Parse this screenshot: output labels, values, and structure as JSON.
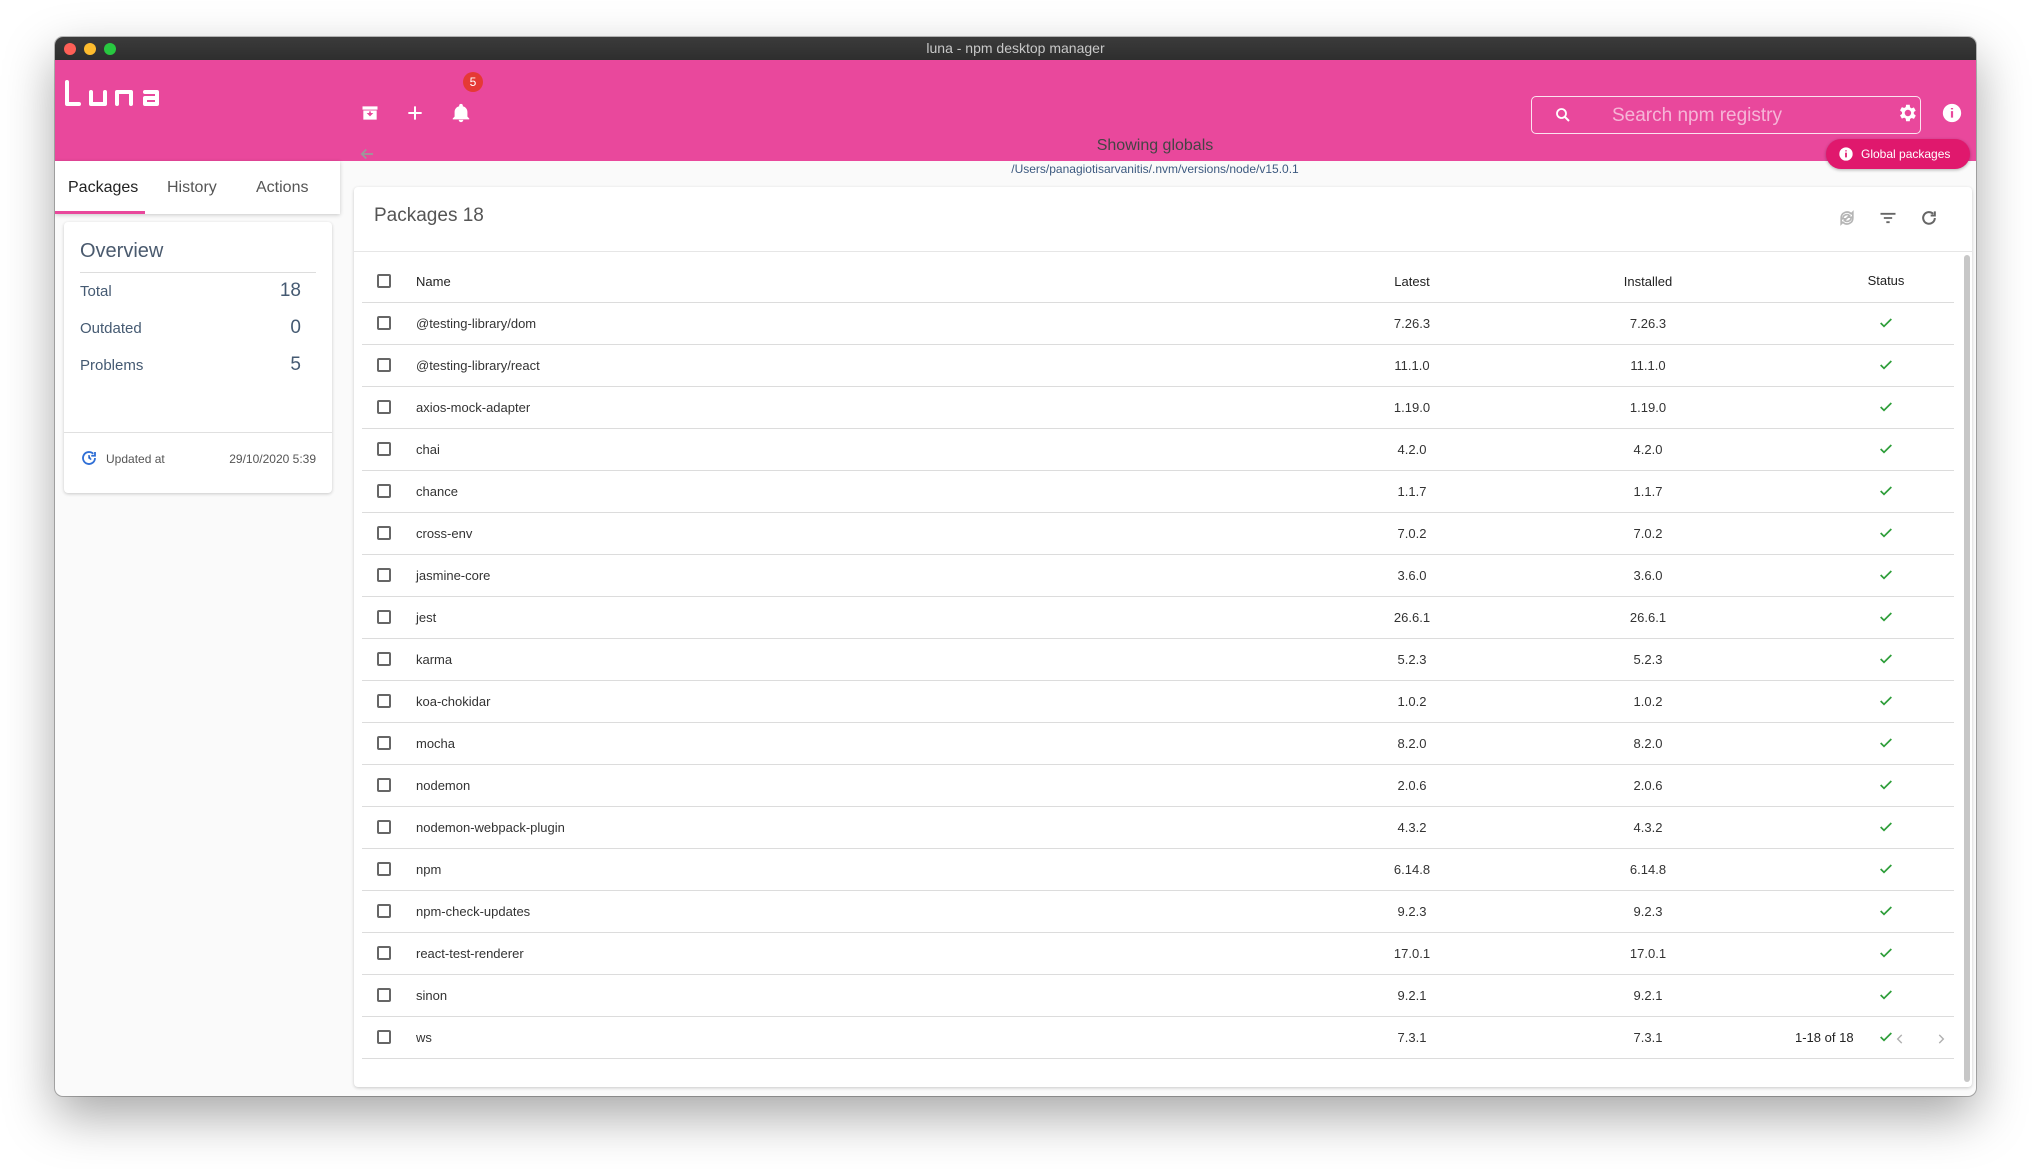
{
  "window": {
    "title": "luna - npm desktop manager"
  },
  "appbar": {
    "logo": "LUNA",
    "notifications_count": "5",
    "search_placeholder": "Search npm registry"
  },
  "sidebar": {
    "tabs": [
      "Packages",
      "History",
      "Actions"
    ],
    "active_tab": "Packages",
    "overview": {
      "title": "Overview",
      "rows": [
        {
          "label": "Total",
          "value": "18"
        },
        {
          "label": "Outdated",
          "value": "0"
        },
        {
          "label": "Problems",
          "value": "5"
        }
      ],
      "updated_label": "Updated at",
      "updated_value": "29/10/2020 5:39"
    }
  },
  "header": {
    "showing": "Showing globals",
    "path": "/Users/panagiotisarvanitis/.nvm/versions/node/v15.0.1",
    "global_button": "Global packages"
  },
  "packages": {
    "title": "Packages 18",
    "columns": {
      "name": "Name",
      "latest": "Latest",
      "installed": "Installed",
      "status": "Status"
    },
    "rows": [
      {
        "name": "@testing-library/dom",
        "latest": "7.26.3",
        "installed": "7.26.3"
      },
      {
        "name": "@testing-library/react",
        "latest": "11.1.0",
        "installed": "11.1.0"
      },
      {
        "name": "axios-mock-adapter",
        "latest": "1.19.0",
        "installed": "1.19.0"
      },
      {
        "name": "chai",
        "latest": "4.2.0",
        "installed": "4.2.0"
      },
      {
        "name": "chance",
        "latest": "1.1.7",
        "installed": "1.1.7"
      },
      {
        "name": "cross-env",
        "latest": "7.0.2",
        "installed": "7.0.2"
      },
      {
        "name": "jasmine-core",
        "latest": "3.6.0",
        "installed": "3.6.0"
      },
      {
        "name": "jest",
        "latest": "26.6.1",
        "installed": "26.6.1"
      },
      {
        "name": "karma",
        "latest": "5.2.3",
        "installed": "5.2.3"
      },
      {
        "name": "koa-chokidar",
        "latest": "1.0.2",
        "installed": "1.0.2"
      },
      {
        "name": "mocha",
        "latest": "8.2.0",
        "installed": "8.2.0"
      },
      {
        "name": "nodemon",
        "latest": "2.0.6",
        "installed": "2.0.6"
      },
      {
        "name": "nodemon-webpack-plugin",
        "latest": "4.3.2",
        "installed": "4.3.2"
      },
      {
        "name": "npm",
        "latest": "6.14.8",
        "installed": "6.14.8"
      },
      {
        "name": "npm-check-updates",
        "latest": "9.2.3",
        "installed": "9.2.3"
      },
      {
        "name": "react-test-renderer",
        "latest": "17.0.1",
        "installed": "17.0.1"
      },
      {
        "name": "sinon",
        "latest": "9.2.1",
        "installed": "9.2.1"
      },
      {
        "name": "ws",
        "latest": "7.3.1",
        "installed": "7.3.1"
      }
    ],
    "pagination": "1-18 of 18"
  },
  "colors": {
    "accent": "#e9489c",
    "global_button": "#e0186d",
    "ok": "#2e9e3a"
  },
  "icons": {
    "status": "check-icon",
    "toolbar": [
      "archive-icon",
      "plus-icon",
      "bell-icon"
    ],
    "actions": [
      "sync-icon",
      "filter-icon",
      "refresh-icon"
    ]
  }
}
